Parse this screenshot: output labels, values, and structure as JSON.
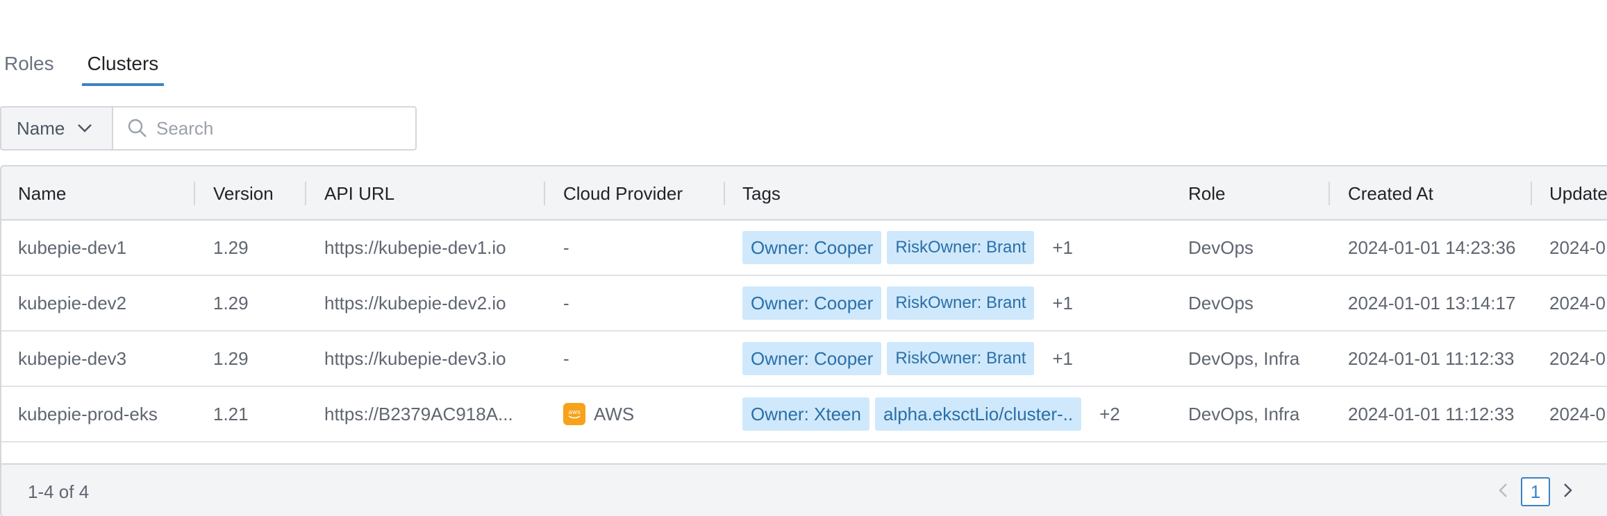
{
  "tabs": [
    {
      "label": "Roles",
      "active": false
    },
    {
      "label": "Clusters",
      "active": true
    }
  ],
  "search": {
    "field": "Name",
    "placeholder": "Search"
  },
  "table": {
    "columns": [
      "Name",
      "Version",
      "API URL",
      "Cloud Provider",
      "Tags",
      "Role",
      "Created At",
      "Updated At"
    ],
    "rows": [
      {
        "name": "kubepie-dev1",
        "version": "1.29",
        "api_url": "https://kubepie-dev1.io",
        "provider": "-",
        "provider_icon": "",
        "tags": [
          "Owner: Cooper",
          "RiskOwner: Brant"
        ],
        "tags_more": "+1",
        "role": "DevOps",
        "created_at": "2024-01-01 14:23:36",
        "updated_at": "2024-0"
      },
      {
        "name": "kubepie-dev2",
        "version": "1.29",
        "api_url": "https://kubepie-dev2.io",
        "provider": "-",
        "provider_icon": "",
        "tags": [
          "Owner: Cooper",
          "RiskOwner: Brant"
        ],
        "tags_more": "+1",
        "role": "DevOps",
        "created_at": "2024-01-01 13:14:17",
        "updated_at": "2024-0"
      },
      {
        "name": "kubepie-dev3",
        "version": "1.29",
        "api_url": "https://kubepie-dev3.io",
        "provider": "-",
        "provider_icon": "",
        "tags": [
          "Owner: Cooper",
          "RiskOwner: Brant"
        ],
        "tags_more": "+1",
        "role": "DevOps, Infra",
        "created_at": "2024-01-01 11:12:33",
        "updated_at": "2024-0"
      },
      {
        "name": "kubepie-prod-eks",
        "version": "1.21",
        "api_url": "https://B2379AC918A...",
        "provider": "AWS",
        "provider_icon": "aws-icon",
        "tags": [
          "Owner: Xteen",
          "alpha.eksctLio/cluster-.."
        ],
        "tags_more": "+2",
        "role": "DevOps, Infra",
        "created_at": "2024-01-01 11:12:33",
        "updated_at": "2024-0"
      }
    ]
  },
  "pagination": {
    "range_text": "1-4 of 4",
    "current_page": "1"
  },
  "colors": {
    "accent": "#3b82c4",
    "tag_bg": "#cfe8fb",
    "tag_text": "#2a6fa8",
    "aws": "#f7a21b"
  }
}
